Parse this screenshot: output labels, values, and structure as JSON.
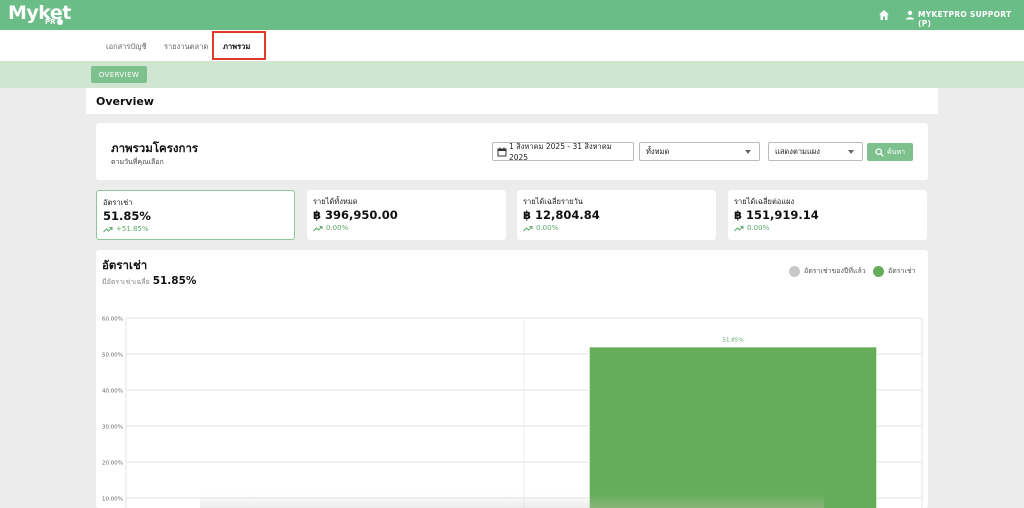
{
  "brand": {
    "name": "Myket",
    "sub": "PR"
  },
  "header": {
    "user": "MYKETPRO SUPPORT (P)"
  },
  "tabs": [
    {
      "label": "เอกสารบัญชี"
    },
    {
      "label": "รายงานตลาด"
    },
    {
      "label": "ภาพรวม"
    }
  ],
  "subnav": {
    "overview": "OVERVIEW"
  },
  "page": {
    "title": "Overview"
  },
  "filter": {
    "title": "ภาพรวมโครงการ",
    "subtitle": "ตามวันที่คุณเลือก",
    "date_range": "1 สิงหาคม 2025 - 31 สิงหาคม 2025",
    "select_all": "ทั้งหมด",
    "select_view": "แสดงตามแผง",
    "search": "ค้นหา"
  },
  "stats": [
    {
      "label": "อัตราเช่า",
      "value": "51.85%",
      "change": "+51.85%"
    },
    {
      "label": "รายได้ทั้งหมด",
      "value": "฿ 396,950.00",
      "change": "0.00%"
    },
    {
      "label": "รายได้เฉลี่ยรายวัน",
      "value": "฿ 12,804.84",
      "change": "0.00%"
    },
    {
      "label": "รายได้เฉลี่ยต่อแผง",
      "value": "฿ 151,919.14",
      "change": "0.00%"
    }
  ],
  "chart": {
    "title": "อัตราเช่า",
    "subtitle": "มีอัตราเช่าเฉลี่ย",
    "subtitle_value": "51.85%"
  },
  "colors": {
    "brand": "#6bbd88",
    "bar": "#65ad58",
    "prev": "#c8c8c8"
  },
  "chart_data": {
    "type": "bar",
    "categories": [
      "",
      ""
    ],
    "series": [
      {
        "name": "อัตราเช่าของปีที่แล้ว",
        "values": [
          0,
          0
        ]
      },
      {
        "name": "อัตราเช่า",
        "values": [
          0,
          51.85
        ]
      }
    ],
    "data_labels": [
      "",
      "51.85%"
    ],
    "yticks": [
      "60.00%",
      "50.00%",
      "40.00%",
      "30.00%",
      "20.00%",
      "10.00%"
    ],
    "ylim": [
      0,
      60
    ],
    "grid": true,
    "legend": "top-right"
  }
}
